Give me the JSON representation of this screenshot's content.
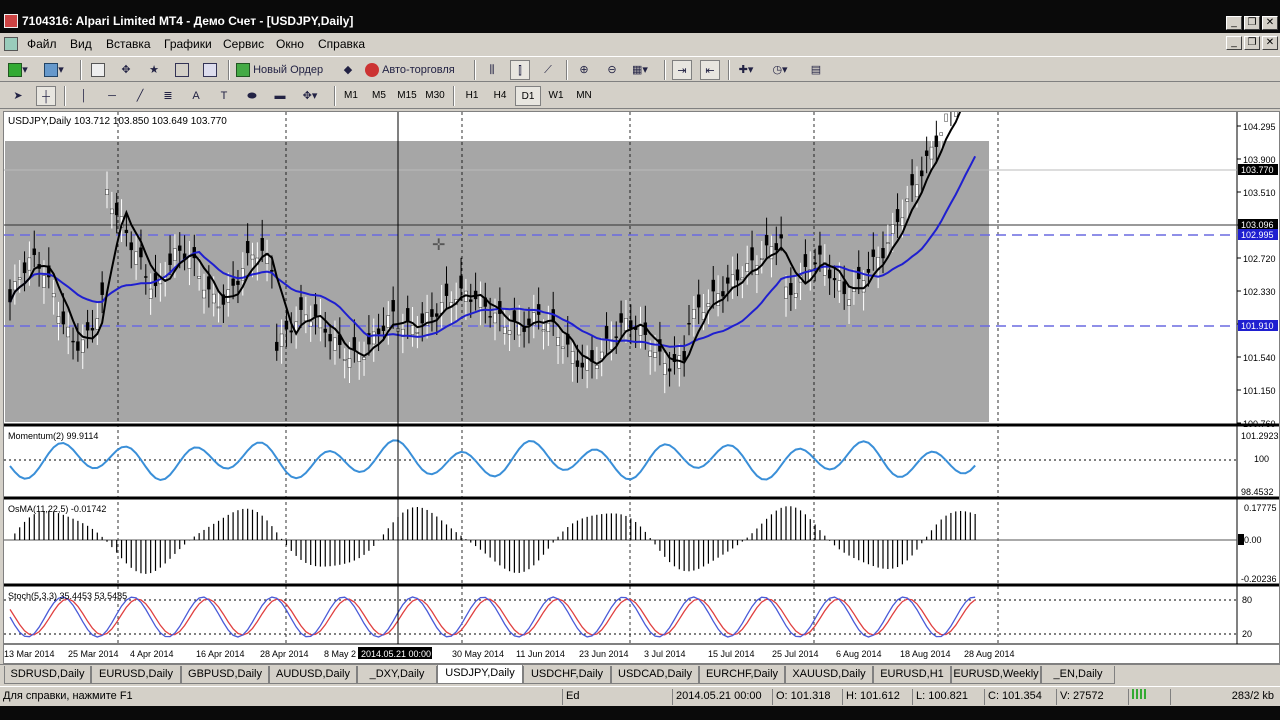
{
  "window": {
    "title": "7104316: Alpari Limited MT4 - Демо Счет - [USDJPY,Daily]"
  },
  "menu": [
    "Файл",
    "Вид",
    "Вставка",
    "Графики",
    "Сервис",
    "Окно",
    "Справка"
  ],
  "toolbar": {
    "new_order": "Новый Ордер",
    "autotrading": "Авто-торговля",
    "timeframes": [
      "M1",
      "M5",
      "M15",
      "M30",
      "H1",
      "H4",
      "D1",
      "W1",
      "MN"
    ],
    "active_timeframe": "D1",
    "search_placeholder": ""
  },
  "chart": {
    "header": "USDJPY,Daily  103.712 103.850 103.649 103.770",
    "price_ticks": [
      "104.295",
      "103.900",
      "103.510",
      "103.120",
      "102.720",
      "102.330",
      "101.940",
      "101.540",
      "101.150",
      "100.760"
    ],
    "markers": {
      "current": "103.770",
      "line1": "103.096",
      "line2": "102.995",
      "line3": "101.910"
    },
    "date_labels": [
      "13 Mar 2014",
      "25 Mar 2014",
      "4 Apr 2014",
      "16 Apr 2014",
      "28 Apr 2014",
      "8 May 2",
      "14",
      "30 May 2014",
      "11 Jun 2014",
      "23 Jun 2014",
      "3 Jul 2014",
      "15 Jul 2014",
      "25 Jul 2014",
      "6 Aug 2014",
      "18 Aug 2014",
      "28 Aug 2014"
    ],
    "crosshair_label": "2014.05.21 00:00",
    "momentum": {
      "label": "Momentum(2) 99.9114",
      "ticks": [
        "101.2923",
        "100",
        "98.4532"
      ]
    },
    "osma": {
      "label": "OsMA(11,22,5) -0.01742",
      "ticks": [
        "0.17775",
        "0.00",
        "-0.20236"
      ]
    },
    "stoch": {
      "label": "Stoch(5,3,3) 35.4453 53.5485",
      "ticks": [
        "80",
        "20"
      ]
    },
    "colors": {
      "bg_band": "#a6a6a6",
      "ma_fast": "#000000",
      "ma_slow": "#1f1fd0",
      "level_line": "#6a6ae0",
      "momentum": "#3a8fd8",
      "stoch_main": "#4a5bd8",
      "stoch_signal": "#e04040"
    }
  },
  "tabs": [
    "SDRUSD,Daily",
    "EURUSD,Daily",
    "GBPUSD,Daily",
    "AUDUSD,Daily",
    "_DXY,Daily",
    "USDJPY,Daily",
    "USDCHF,Daily",
    "USDCAD,Daily",
    "EURCHF,Daily",
    "XAUUSD,Daily",
    "EURUSD,H1",
    "EURUSD,Weekly",
    "_EN,Daily"
  ],
  "active_tab": "USDJPY,Daily",
  "status": {
    "help": "Для справки, нажмите F1",
    "profile": "Ed",
    "datetime": "2014.05.21 00:00",
    "open": "O: 101.318",
    "high": "H: 101.612",
    "low": "L: 100.821",
    "close": "C: 101.354",
    "volume": "V: 27572",
    "traffic": "283/2 kb"
  }
}
